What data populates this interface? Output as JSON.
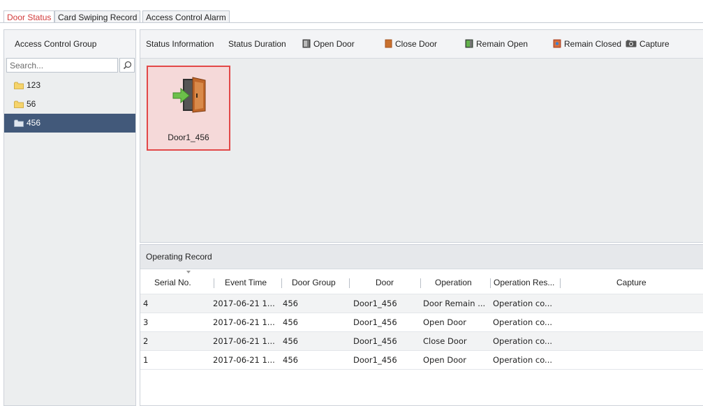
{
  "tabs": [
    {
      "label": "Door Status",
      "active": true
    },
    {
      "label": "Card Swiping Record",
      "active": false
    },
    {
      "label": "Access Control Alarm",
      "active": false
    }
  ],
  "left_panel": {
    "header": "Access Control Group",
    "search": {
      "placeholder": "Search...",
      "value": ""
    },
    "groups": [
      {
        "label": "123",
        "selected": false
      },
      {
        "label": "56",
        "selected": false
      },
      {
        "label": "456",
        "selected": true
      }
    ]
  },
  "toolbar": {
    "status_information": "Status Information",
    "status_duration": "Status Duration",
    "open_door": "Open Door",
    "close_door": "Close Door",
    "remain_open": "Remain Open",
    "remain_closed": "Remain Closed",
    "capture": "Capture"
  },
  "doors": [
    {
      "label": "Door1_456",
      "selected": true
    }
  ],
  "operating_record": {
    "title": "Operating Record",
    "columns": [
      "Serial No.",
      "Event Time",
      "Door Group",
      "Door",
      "Operation",
      "Operation Res...",
      "Capture"
    ],
    "rows": [
      {
        "serial": "4",
        "time": "2017-06-21 1...",
        "group": "456",
        "door": "Door1_456",
        "operation": "Door Remain ...",
        "result": "Operation co...",
        "capture": ""
      },
      {
        "serial": "3",
        "time": "2017-06-21 1...",
        "group": "456",
        "door": "Door1_456",
        "operation": "Open Door",
        "result": "Operation co...",
        "capture": ""
      },
      {
        "serial": "2",
        "time": "2017-06-21 1...",
        "group": "456",
        "door": "Door1_456",
        "operation": "Close Door",
        "result": "Operation co...",
        "capture": ""
      },
      {
        "serial": "1",
        "time": "2017-06-21 1...",
        "group": "456",
        "door": "Door1_456",
        "operation": "Open Door",
        "result": "Operation co...",
        "capture": ""
      }
    ]
  },
  "colors": {
    "active_tab_text": "#d23a3a",
    "selection": "#42597a",
    "door_tile_border": "#e24848",
    "door_tile_bg": "#f5d9d9"
  },
  "icons": [
    "search-icon",
    "folder-icon",
    "open-door-icon",
    "close-door-icon",
    "remain-open-icon",
    "remain-closed-icon",
    "camera-icon",
    "door-open-arrow-icon"
  ]
}
